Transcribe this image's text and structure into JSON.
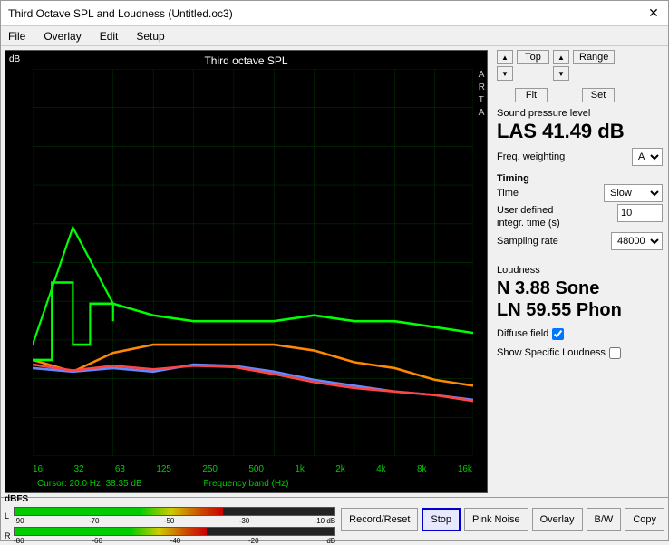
{
  "window": {
    "title": "Third Octave SPL and Loudness (Untitled.oc3)"
  },
  "menu": {
    "items": [
      "File",
      "Overlay",
      "Edit",
      "Setup"
    ]
  },
  "chart": {
    "title": "Third octave SPL",
    "y_label": "dB",
    "y_top": "100.0",
    "x_labels": [
      "16",
      "32",
      "63",
      "125",
      "250",
      "500",
      "1k",
      "2k",
      "4k",
      "8k",
      "16k"
    ],
    "x_title": "Frequency band (Hz)",
    "cursor_info": "Cursor:  20.0 Hz, 38.35 dB",
    "arta_label": "A\nR\nT\nA"
  },
  "top_controls": {
    "top_label": "Top",
    "fit_label": "Fit",
    "range_label": "Range",
    "set_label": "Set"
  },
  "spl": {
    "section_label": "Sound pressure level",
    "value": "LAS 41.49 dB",
    "freq_weighting_label": "Freq. weighting",
    "freq_weighting_value": "A"
  },
  "timing": {
    "section_label": "Timing",
    "time_label": "Time",
    "time_value": "Slow",
    "user_defined_label": "User defined integr. time (s)",
    "user_defined_value": "10",
    "sampling_rate_label": "Sampling rate",
    "sampling_rate_value": "48000"
  },
  "loudness": {
    "section_label": "Loudness",
    "n_value": "N 3.88 Sone",
    "ln_value": "LN 59.55 Phon",
    "diffuse_field_label": "Diffuse field",
    "show_specific_label": "Show Specific Loudness"
  },
  "bottom_buttons": {
    "record_reset": "Record/Reset",
    "stop": "Stop",
    "pink_noise": "Pink Noise",
    "overlay": "Overlay",
    "bw": "B/W",
    "copy": "Copy"
  },
  "dbfs": {
    "label": "dBFS",
    "scale_marks": [
      "-90",
      "-70",
      "-50",
      "-30",
      "-10 dB"
    ],
    "scale_marks_r": [
      "-80",
      "-60",
      "-40",
      "-20",
      "dB"
    ],
    "l_label": "L",
    "r_label": "R",
    "l_fill_percent": 65,
    "r_fill_percent": 60
  }
}
